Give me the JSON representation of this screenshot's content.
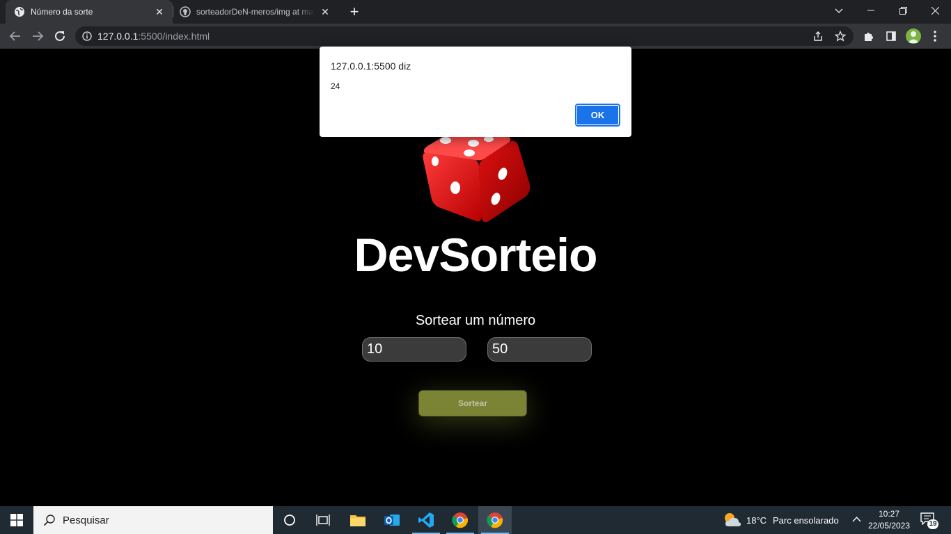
{
  "browser": {
    "tabs": [
      {
        "title": "Número da sorte",
        "active": true,
        "icon": "globe-icon"
      },
      {
        "title": "sorteadorDeN-meros/img at master",
        "active": false,
        "icon": "github-icon"
      }
    ],
    "url_host": "127.0.0.1",
    "url_path": ":5500/index.html"
  },
  "page": {
    "brand": "DevSorteio",
    "subtitle": "Sortear um número",
    "min_value": "10",
    "max_value": "50",
    "button_label": "Sortear",
    "accent_color": "#7a8434"
  },
  "dialog": {
    "origin": "127.0.0.1:5500 diz",
    "message": "24",
    "ok_label": "OK"
  },
  "taskbar": {
    "search_placeholder": "Pesquisar",
    "weather_temp": "18°C",
    "weather_desc": "Parc ensolarado",
    "time": "10:27",
    "date": "22/05/2023",
    "notification_count": "19"
  }
}
